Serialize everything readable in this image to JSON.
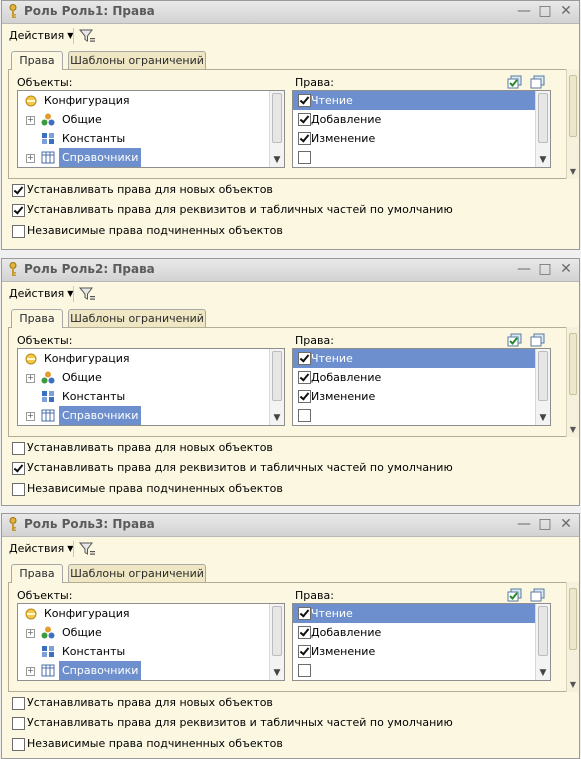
{
  "windows": [
    {
      "title": "Роль Роль1: Права",
      "actions_label": "Действия",
      "tabs": [
        "Права",
        "Шаблоны ограничений"
      ],
      "objects_label": "Объекты:",
      "rights_label": "Права:",
      "tree": [
        "Конфигурация",
        "Общие",
        "Константы",
        "Справочники"
      ],
      "rights": [
        {
          "label": "Чтение",
          "checked": true
        },
        {
          "label": "Добавление",
          "checked": true
        },
        {
          "label": "Изменение",
          "checked": true
        }
      ],
      "options": [
        {
          "label": "Устанавливать права для новых объектов",
          "checked": true
        },
        {
          "label": "Устанавливать права для реквизитов и табличных частей по умолчанию",
          "checked": true
        },
        {
          "label": "Независимые права подчиненных объектов",
          "checked": false
        }
      ]
    },
    {
      "title": "Роль Роль2: Права",
      "actions_label": "Действия",
      "tabs": [
        "Права",
        "Шаблоны ограничений"
      ],
      "objects_label": "Объекты:",
      "rights_label": "Права:",
      "tree": [
        "Конфигурация",
        "Общие",
        "Константы",
        "Справочники"
      ],
      "rights": [
        {
          "label": "Чтение",
          "checked": true
        },
        {
          "label": "Добавление",
          "checked": true
        },
        {
          "label": "Изменение",
          "checked": true
        }
      ],
      "options": [
        {
          "label": "Устанавливать права для новых объектов",
          "checked": false
        },
        {
          "label": "Устанавливать права для реквизитов и табличных частей по умолчанию",
          "checked": true
        },
        {
          "label": "Независимые права подчиненных объектов",
          "checked": false
        }
      ]
    },
    {
      "title": "Роль Роль3: Права",
      "actions_label": "Действия",
      "tabs": [
        "Права",
        "Шаблоны ограничений"
      ],
      "objects_label": "Объекты:",
      "rights_label": "Права:",
      "tree": [
        "Конфигурация",
        "Общие",
        "Константы",
        "Справочники"
      ],
      "rights": [
        {
          "label": "Чтение",
          "checked": true
        },
        {
          "label": "Добавление",
          "checked": true
        },
        {
          "label": "Изменение",
          "checked": true
        }
      ],
      "options": [
        {
          "label": "Устанавливать права для новых объектов",
          "checked": false
        },
        {
          "label": "Устанавливать права для реквизитов и табличных частей по умолчанию",
          "checked": false
        },
        {
          "label": "Независимые права подчиненных объектов",
          "checked": false
        }
      ]
    }
  ],
  "colors": {
    "selection": "#6d8fce",
    "window_bg": "#fbf7e1",
    "title_bar": "#d8d8d8"
  }
}
